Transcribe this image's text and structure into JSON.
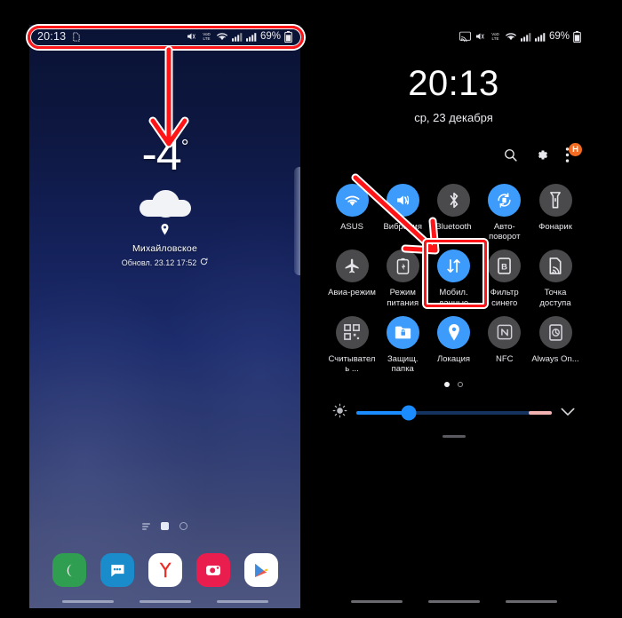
{
  "left_phone": {
    "statusbar": {
      "time": "20:13",
      "icons_left": [
        "sim-card-icon"
      ],
      "icons_right": [
        "mute-vibrate-icon",
        "volte-icon",
        "wifi-icon",
        "signal-sim1-icon",
        "signal-sim2-icon"
      ],
      "battery_percent": "69%"
    },
    "weather": {
      "temperature": "-4",
      "degree": "°",
      "condition_icon": "cloud-icon",
      "location": "Михайловское",
      "updated": "Обновл. 23.12 17:52",
      "refresh_icon": "refresh-icon"
    },
    "page_indicators": [
      "lines-icon",
      "home-icon",
      "circle-icon"
    ],
    "dock": [
      {
        "name": "phone-app",
        "icon": "phone-icon",
        "color": "#2f9e51"
      },
      {
        "name": "messages-app",
        "icon": "message-bubble-icon",
        "color": "#1a8ccc"
      },
      {
        "name": "yandex-app",
        "icon": "yandex-y-icon",
        "color": "#ffffff"
      },
      {
        "name": "camera-app",
        "icon": "camera-icon",
        "color": "#ea1e4e"
      },
      {
        "name": "play-store-app",
        "icon": "play-triangle-icon",
        "color": "#ffffff"
      }
    ]
  },
  "right_phone": {
    "statusbar": {
      "icons_right": [
        "screen-cast-icon",
        "mute-vibrate-icon",
        "volte-icon",
        "wifi-icon",
        "signal-sim1-icon",
        "signal-sim2-icon"
      ],
      "battery_percent": "69%"
    },
    "clock": {
      "time": "20:13",
      "date": "ср, 23 декабря"
    },
    "actions": [
      {
        "name": "search-icon",
        "label": "search"
      },
      {
        "name": "gear-icon",
        "label": "settings"
      },
      {
        "name": "overflow-menu-icon",
        "label": "more",
        "badge": "H",
        "badge_color": "#f26b21"
      }
    ],
    "tiles": [
      [
        {
          "label": "ASUS",
          "icon": "wifi-icon",
          "state": "on"
        },
        {
          "label": "Вибрация",
          "icon": "vibrate-icon",
          "state": "on"
        },
        {
          "label": "Bluetooth",
          "icon": "bluetooth-icon",
          "state": "off",
          "highlighted": true
        },
        {
          "label": "Авто-поворот",
          "icon": "auto-rotate-icon",
          "state": "on"
        },
        {
          "label": "Фонарик",
          "icon": "flashlight-icon",
          "state": "off"
        }
      ],
      [
        {
          "label": "Авиа-режим",
          "icon": "airplane-icon",
          "state": "off"
        },
        {
          "label": "Режим питания",
          "icon": "power-mode-icon",
          "state": "off"
        },
        {
          "label": "Мобил. данные",
          "icon": "mobile-data-icon",
          "state": "on"
        },
        {
          "label": "Фильтр синего",
          "icon": "blue-light-filter-icon",
          "state": "off"
        },
        {
          "label": "Точка доступа",
          "icon": "hotspot-icon",
          "state": "off"
        }
      ],
      [
        {
          "label": "Считыватель ...",
          "icon": "qr-scanner-icon",
          "state": "off"
        },
        {
          "label": "Защищ. папка",
          "icon": "secure-folder-icon",
          "state": "on"
        },
        {
          "label": "Локация",
          "icon": "location-pin-icon",
          "state": "on"
        },
        {
          "label": "NFC",
          "icon": "nfc-icon",
          "state": "off"
        },
        {
          "label": "Always On...",
          "icon": "always-on-display-icon",
          "state": "off"
        }
      ]
    ],
    "page_dots": {
      "count": 2,
      "active_index": 0
    },
    "brightness": {
      "icon": "brightness-icon",
      "value_percent": 27,
      "expand_icon": "chevron-down-icon"
    }
  },
  "annotations": {
    "accent_color": "#ff1418",
    "statusbar_highlight": "status-bar-highlight-box",
    "statusbar_arrow": "arrow-down-to-weather",
    "bluetooth_highlight": "bluetooth-tile-highlight-box",
    "bluetooth_arrow": "arrow-to-bluetooth-tile"
  }
}
